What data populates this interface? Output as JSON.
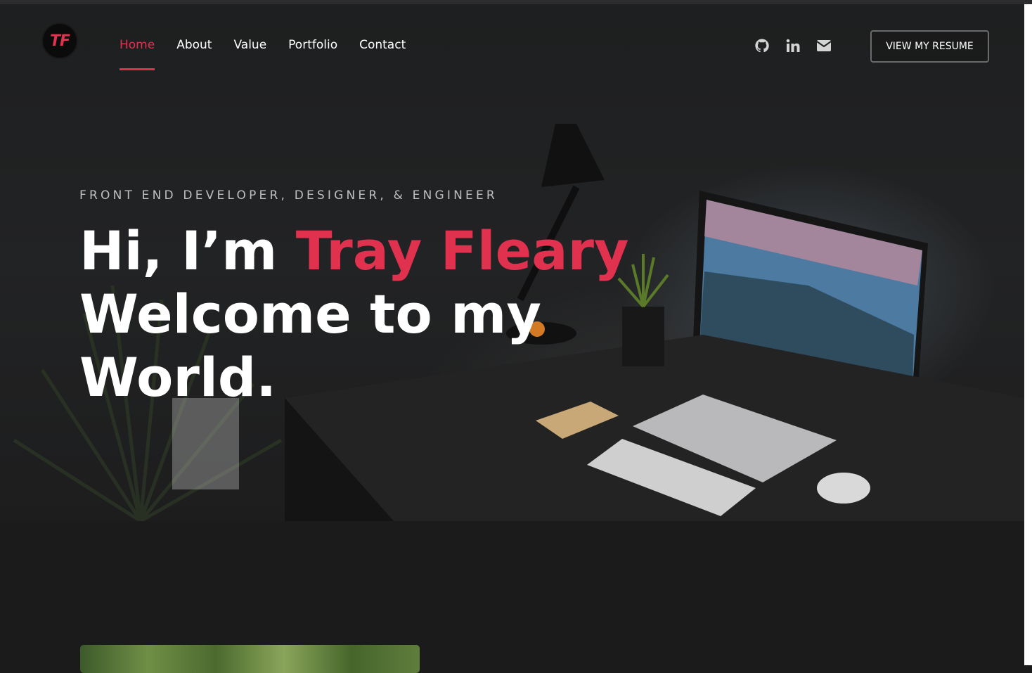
{
  "logo": {
    "text": "TF"
  },
  "nav": {
    "items": [
      {
        "label": "Home",
        "active": true
      },
      {
        "label": "About",
        "active": false
      },
      {
        "label": "Value",
        "active": false
      },
      {
        "label": "Portfolio",
        "active": false
      },
      {
        "label": "Contact",
        "active": false
      }
    ]
  },
  "social": {
    "icons": [
      "github-icon",
      "linkedin-icon",
      "envelope-icon"
    ]
  },
  "resume_button": {
    "label": "VIEW MY RESUME"
  },
  "hero": {
    "kicker": "FRONT END DEVELOPER, DESIGNER, & ENGINEER",
    "greeting": "Hi, I’m ",
    "name": "Tray Fleary",
    "line2": "Welcome to my",
    "line3": "World."
  },
  "colors": {
    "accent": "#e0314f",
    "background": "#1b1b1c",
    "text": "#ffffff"
  }
}
